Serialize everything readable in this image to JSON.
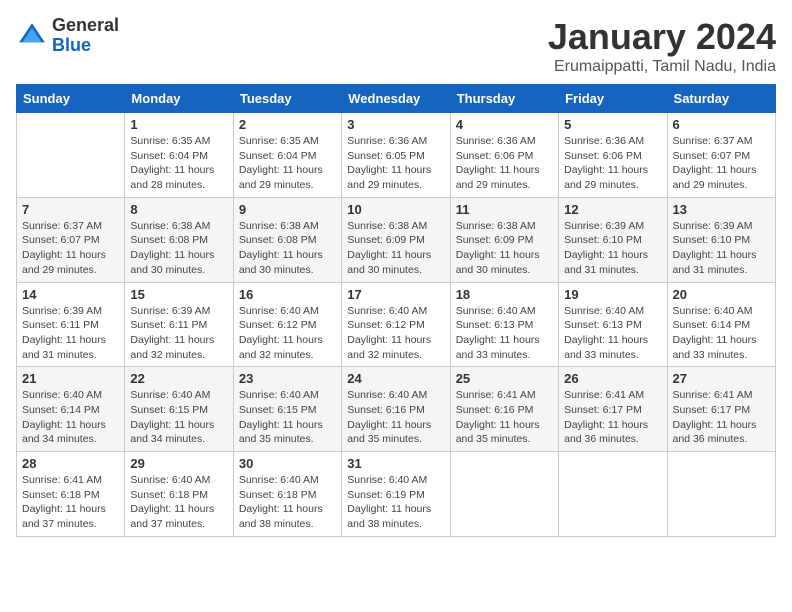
{
  "logo": {
    "general": "General",
    "blue": "Blue"
  },
  "title": "January 2024",
  "subtitle": "Erumaippatti, Tamil Nadu, India",
  "days_header": [
    "Sunday",
    "Monday",
    "Tuesday",
    "Wednesday",
    "Thursday",
    "Friday",
    "Saturday"
  ],
  "weeks": [
    [
      {
        "day": "",
        "info": ""
      },
      {
        "day": "1",
        "info": "Sunrise: 6:35 AM\nSunset: 6:04 PM\nDaylight: 11 hours\nand 28 minutes."
      },
      {
        "day": "2",
        "info": "Sunrise: 6:35 AM\nSunset: 6:04 PM\nDaylight: 11 hours\nand 29 minutes."
      },
      {
        "day": "3",
        "info": "Sunrise: 6:36 AM\nSunset: 6:05 PM\nDaylight: 11 hours\nand 29 minutes."
      },
      {
        "day": "4",
        "info": "Sunrise: 6:36 AM\nSunset: 6:06 PM\nDaylight: 11 hours\nand 29 minutes."
      },
      {
        "day": "5",
        "info": "Sunrise: 6:36 AM\nSunset: 6:06 PM\nDaylight: 11 hours\nand 29 minutes."
      },
      {
        "day": "6",
        "info": "Sunrise: 6:37 AM\nSunset: 6:07 PM\nDaylight: 11 hours\nand 29 minutes."
      }
    ],
    [
      {
        "day": "7",
        "info": "Sunrise: 6:37 AM\nSunset: 6:07 PM\nDaylight: 11 hours\nand 29 minutes."
      },
      {
        "day": "8",
        "info": "Sunrise: 6:38 AM\nSunset: 6:08 PM\nDaylight: 11 hours\nand 30 minutes."
      },
      {
        "day": "9",
        "info": "Sunrise: 6:38 AM\nSunset: 6:08 PM\nDaylight: 11 hours\nand 30 minutes."
      },
      {
        "day": "10",
        "info": "Sunrise: 6:38 AM\nSunset: 6:09 PM\nDaylight: 11 hours\nand 30 minutes."
      },
      {
        "day": "11",
        "info": "Sunrise: 6:38 AM\nSunset: 6:09 PM\nDaylight: 11 hours\nand 30 minutes."
      },
      {
        "day": "12",
        "info": "Sunrise: 6:39 AM\nSunset: 6:10 PM\nDaylight: 11 hours\nand 31 minutes."
      },
      {
        "day": "13",
        "info": "Sunrise: 6:39 AM\nSunset: 6:10 PM\nDaylight: 11 hours\nand 31 minutes."
      }
    ],
    [
      {
        "day": "14",
        "info": "Sunrise: 6:39 AM\nSunset: 6:11 PM\nDaylight: 11 hours\nand 31 minutes."
      },
      {
        "day": "15",
        "info": "Sunrise: 6:39 AM\nSunset: 6:11 PM\nDaylight: 11 hours\nand 32 minutes."
      },
      {
        "day": "16",
        "info": "Sunrise: 6:40 AM\nSunset: 6:12 PM\nDaylight: 11 hours\nand 32 minutes."
      },
      {
        "day": "17",
        "info": "Sunrise: 6:40 AM\nSunset: 6:12 PM\nDaylight: 11 hours\nand 32 minutes."
      },
      {
        "day": "18",
        "info": "Sunrise: 6:40 AM\nSunset: 6:13 PM\nDaylight: 11 hours\nand 33 minutes."
      },
      {
        "day": "19",
        "info": "Sunrise: 6:40 AM\nSunset: 6:13 PM\nDaylight: 11 hours\nand 33 minutes."
      },
      {
        "day": "20",
        "info": "Sunrise: 6:40 AM\nSunset: 6:14 PM\nDaylight: 11 hours\nand 33 minutes."
      }
    ],
    [
      {
        "day": "21",
        "info": "Sunrise: 6:40 AM\nSunset: 6:14 PM\nDaylight: 11 hours\nand 34 minutes."
      },
      {
        "day": "22",
        "info": "Sunrise: 6:40 AM\nSunset: 6:15 PM\nDaylight: 11 hours\nand 34 minutes."
      },
      {
        "day": "23",
        "info": "Sunrise: 6:40 AM\nSunset: 6:15 PM\nDaylight: 11 hours\nand 35 minutes."
      },
      {
        "day": "24",
        "info": "Sunrise: 6:40 AM\nSunset: 6:16 PM\nDaylight: 11 hours\nand 35 minutes."
      },
      {
        "day": "25",
        "info": "Sunrise: 6:41 AM\nSunset: 6:16 PM\nDaylight: 11 hours\nand 35 minutes."
      },
      {
        "day": "26",
        "info": "Sunrise: 6:41 AM\nSunset: 6:17 PM\nDaylight: 11 hours\nand 36 minutes."
      },
      {
        "day": "27",
        "info": "Sunrise: 6:41 AM\nSunset: 6:17 PM\nDaylight: 11 hours\nand 36 minutes."
      }
    ],
    [
      {
        "day": "28",
        "info": "Sunrise: 6:41 AM\nSunset: 6:18 PM\nDaylight: 11 hours\nand 37 minutes."
      },
      {
        "day": "29",
        "info": "Sunrise: 6:40 AM\nSunset: 6:18 PM\nDaylight: 11 hours\nand 37 minutes."
      },
      {
        "day": "30",
        "info": "Sunrise: 6:40 AM\nSunset: 6:18 PM\nDaylight: 11 hours\nand 38 minutes."
      },
      {
        "day": "31",
        "info": "Sunrise: 6:40 AM\nSunset: 6:19 PM\nDaylight: 11 hours\nand 38 minutes."
      },
      {
        "day": "",
        "info": ""
      },
      {
        "day": "",
        "info": ""
      },
      {
        "day": "",
        "info": ""
      }
    ]
  ]
}
